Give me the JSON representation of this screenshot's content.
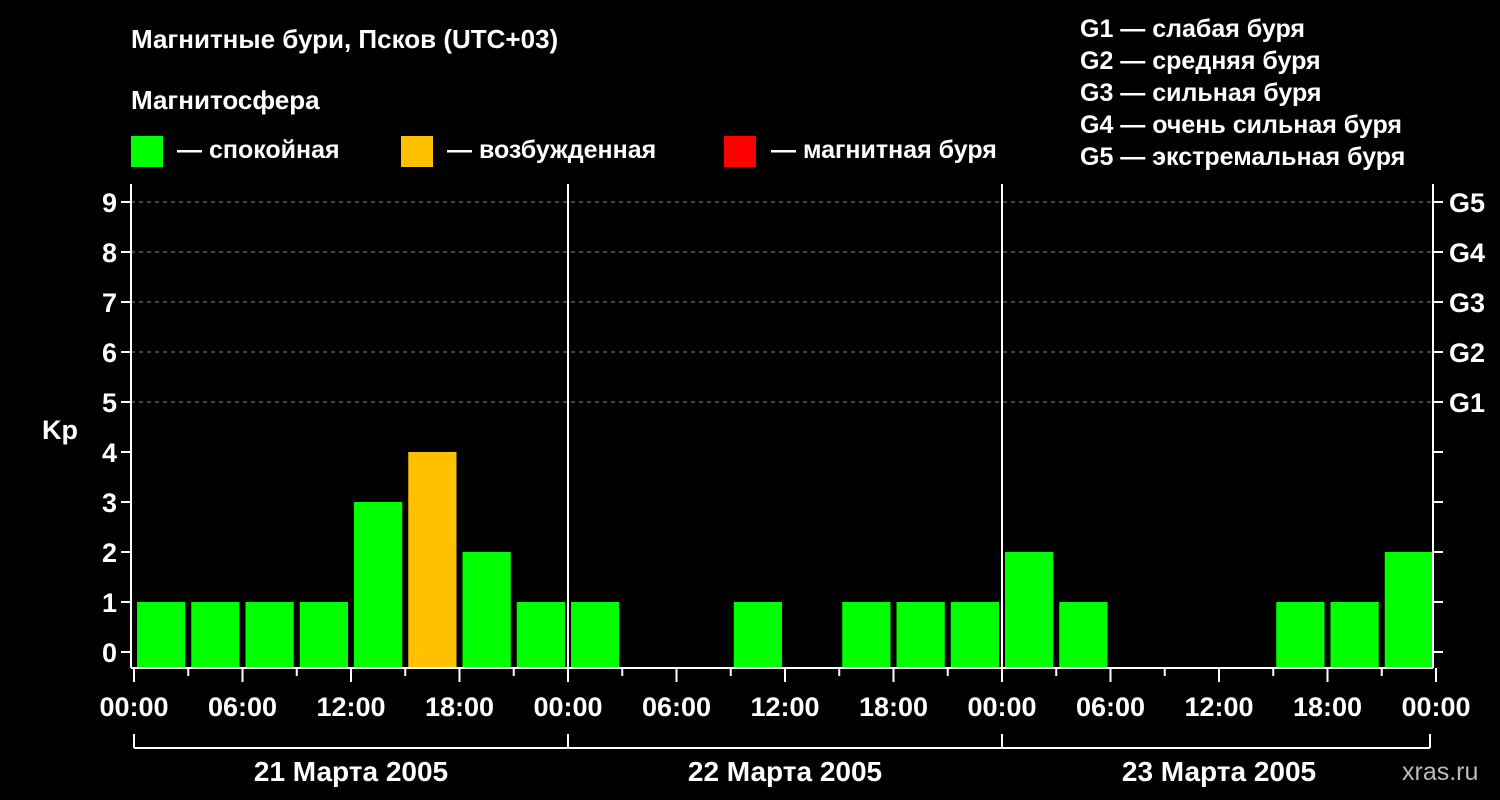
{
  "title": "Магнитные бури, Псков (UTC+03)",
  "watermark": "xras.ru",
  "legend": {
    "heading": "Магнитосфера",
    "items": [
      {
        "color": "#00ff00",
        "label": "— спокойная"
      },
      {
        "color": "#ffc000",
        "label": "— возбужденная"
      },
      {
        "color": "#ff0000",
        "label": "— магнитная буря"
      }
    ],
    "storm_levels": [
      "G1 — слабая буря",
      "G2 — средняя буря",
      "G3 — сильная буря",
      "G4 — очень сильная буря",
      "G5 — экстремальная буря"
    ]
  },
  "chart_data": {
    "type": "bar",
    "ylabel": "Kp",
    "ylim": [
      0,
      9
    ],
    "y_ticks": [
      "0",
      "1",
      "2",
      "3",
      "4",
      "5",
      "6",
      "7",
      "8",
      "9"
    ],
    "g_labels": [
      "G1",
      "G2",
      "G3",
      "G4",
      "G5"
    ],
    "x_tick_labels": [
      "00:00",
      "06:00",
      "12:00",
      "18:00",
      "00:00",
      "06:00",
      "12:00",
      "18:00",
      "00:00",
      "06:00",
      "12:00",
      "18:00",
      "00:00"
    ],
    "days": [
      "21 Марта 2005",
      "22 Марта 2005",
      "23 Марта 2005"
    ],
    "interval_hours": 3,
    "grid": "dashed horizontal at Kp 5-9",
    "values": [
      1,
      1,
      1,
      1,
      3,
      4,
      2,
      1,
      1,
      0,
      0,
      1,
      0,
      1,
      1,
      1,
      2,
      1,
      0,
      0,
      0,
      1,
      1,
      2
    ],
    "colors": {
      "quiet": "#00ff00",
      "active": "#ffc000",
      "storm": "#ff0000"
    }
  }
}
